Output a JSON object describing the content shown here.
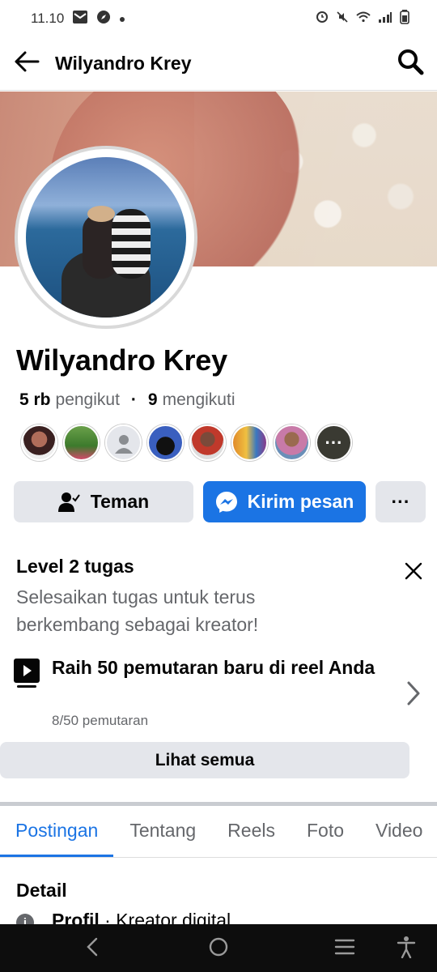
{
  "status_bar": {
    "time": "11.10"
  },
  "header": {
    "title": "Wilyandro Krey"
  },
  "profile": {
    "name": "Wilyandro Krey",
    "followers_count": "5 rb",
    "followers_label": "pengikut",
    "following_count": "9",
    "following_label": "mengikuti"
  },
  "actions": {
    "friend_label": "Teman",
    "message_label": "Kirim pesan",
    "more_label": "···"
  },
  "level_card": {
    "title": "Level 2 tugas",
    "description": "Selesaikan tugas untuk terus berkembang sebagai kreator!",
    "task_title": "Raih 50 pemutaran baru di reel Anda",
    "task_progress": "8/50 pemutaran",
    "task_progress_value": 0.16,
    "see_all_label": "Lihat semua"
  },
  "tabs": [
    "Postingan",
    "Tentang",
    "Reels",
    "Foto",
    "Video"
  ],
  "active_tab": "Postingan",
  "details": {
    "title": "Detail",
    "row_label": "Profil",
    "row_value": " · Kreator digital"
  },
  "icons": {
    "back": "arrow-left-icon",
    "search": "search-icon",
    "friend": "person-check-icon",
    "messenger": "messenger-icon",
    "close": "close-icon",
    "reel": "reel-play-icon",
    "chevron": "chevron-right-icon",
    "info": "info-icon"
  },
  "colors": {
    "accent": "#1b74e4",
    "muted": "#65676b",
    "button_gray": "#e4e6eb"
  }
}
